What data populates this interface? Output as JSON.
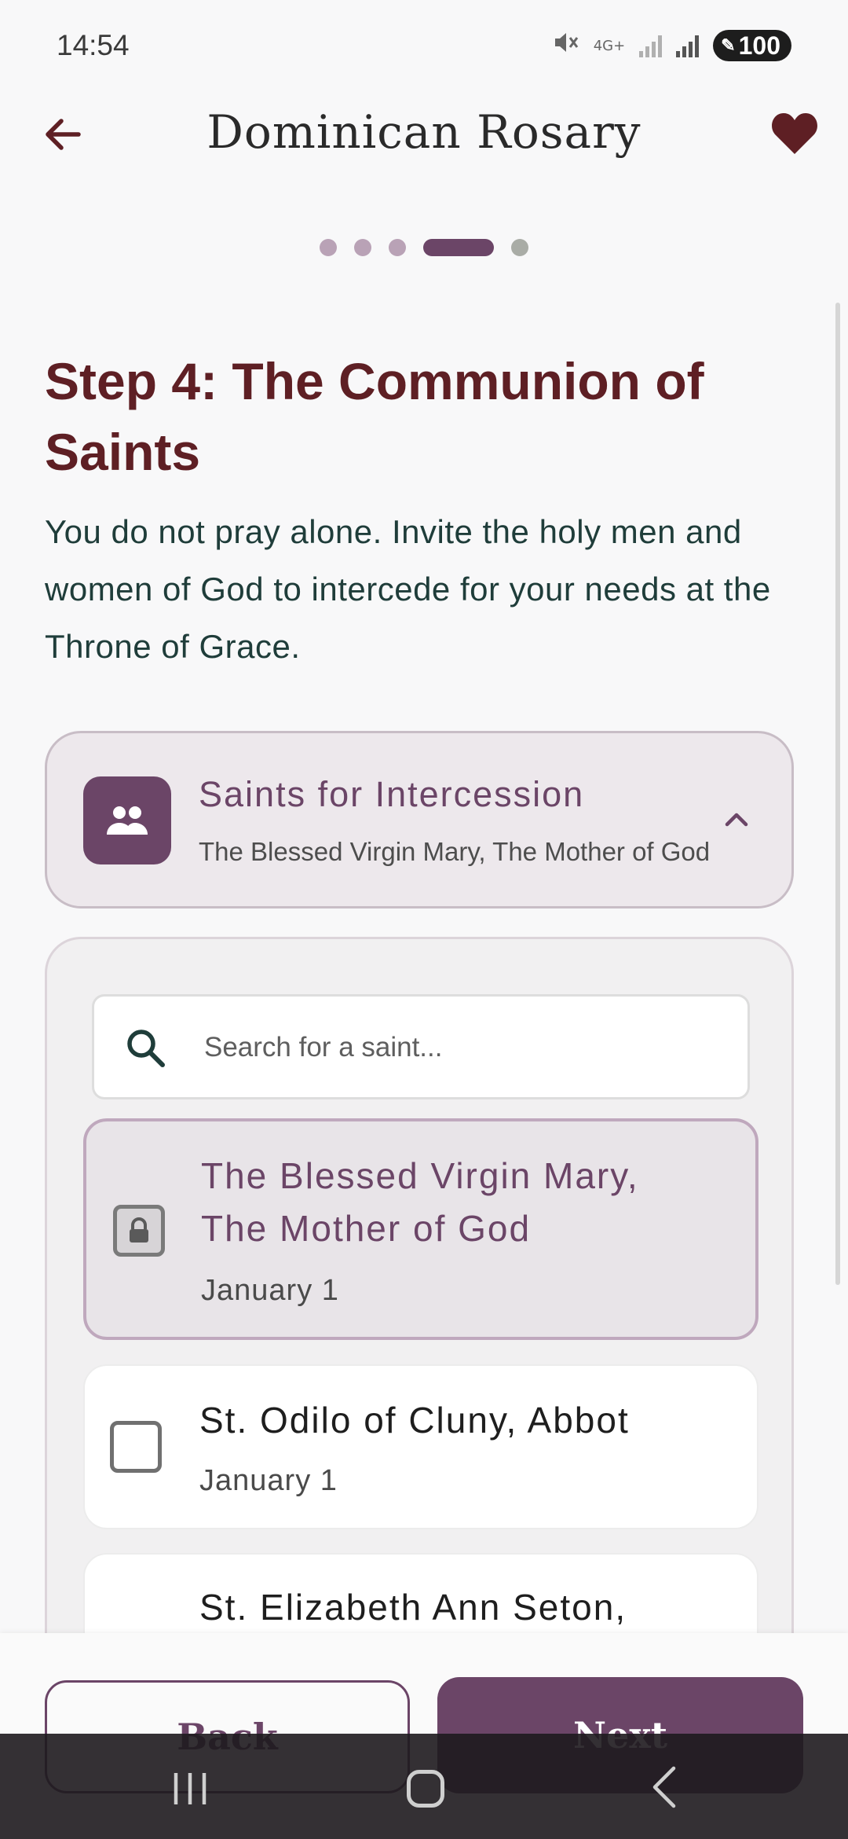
{
  "status": {
    "time": "14:54",
    "network": "4G+",
    "battery": "100"
  },
  "appbar": {
    "title": "Dominican Rosary",
    "back_icon": "arrow-left-icon",
    "favorite_icon": "heart-icon"
  },
  "progress": {
    "total_steps": 5,
    "current_step": 4
  },
  "step": {
    "title": "Step 4: The Communion of Saints",
    "description": "You do not pray alone. Invite the holy men and women of God to intercede for your needs at the Throne of Grace."
  },
  "accordion": {
    "title": "Saints for Intercession",
    "subtitle": "The Blessed Virgin Mary, The Mother of God",
    "icon": "people-icon",
    "expanded": true
  },
  "search": {
    "placeholder": "Search for a saint..."
  },
  "saints": [
    {
      "name_line1": "The Blessed Virgin Mary,",
      "name_line2": "The Mother of God",
      "date": "January 1",
      "locked": true
    },
    {
      "name_line1": "St. Odilo of Cluny, Abbot",
      "date": "January 1",
      "checked": false
    },
    {
      "name_line1": "St. Elizabeth Ann Seton,",
      "checked": false
    }
  ],
  "buttons": {
    "back": "Back",
    "next": "Next"
  },
  "colors": {
    "primary": "#6b4567",
    "title": "#5e1f24",
    "text": "#1f3d3a",
    "heart": "#5e1f24"
  }
}
